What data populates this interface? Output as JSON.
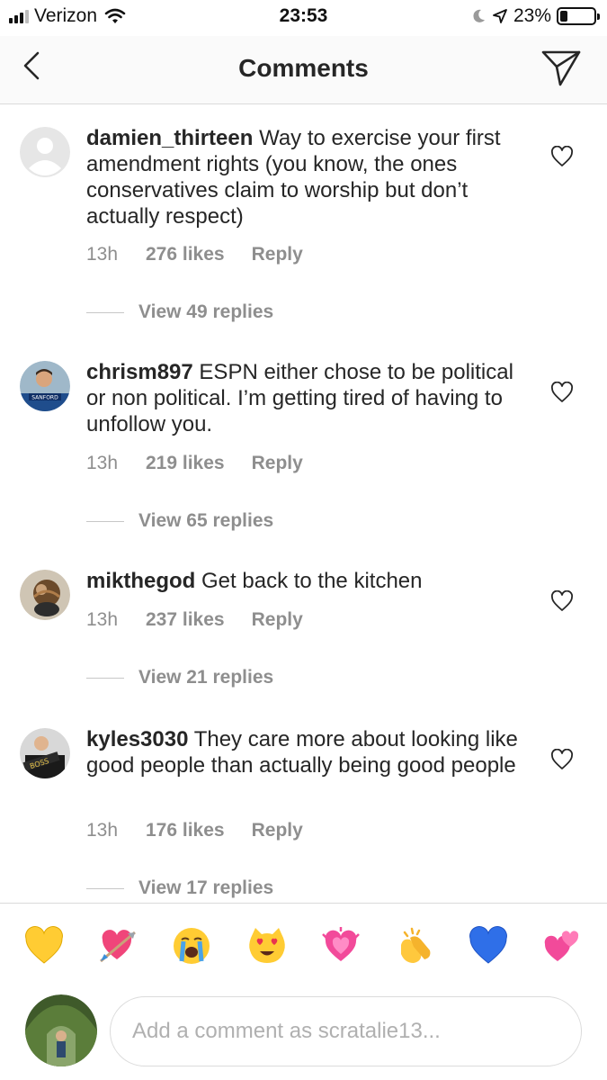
{
  "status_bar": {
    "carrier": "Verizon",
    "time": "23:53",
    "battery_percent": "23%",
    "battery_level": 0.23,
    "signal_bars_filled": 3,
    "signal_bars_total": 4
  },
  "header": {
    "title": "Comments",
    "back_icon": "chevron-left-icon",
    "send_icon": "paper-plane-icon"
  },
  "comments": [
    {
      "username": "damien_thirteen",
      "text": "Way to exercise your first amendment rights (you know, the ones conservatives claim to worship but don’t actually respect)",
      "time": "13h",
      "likes": "276 likes",
      "reply": "Reply",
      "view_replies": "View 49 replies"
    },
    {
      "username": "chrism897",
      "text": "ESPN either chose to be political or non political. I’m getting tired of having to unfollow you.",
      "time": "13h",
      "likes": "219 likes",
      "reply": "Reply",
      "view_replies": "View 65 replies"
    },
    {
      "username": "mikthegod",
      "text": "Get back to the kitchen",
      "time": "13h",
      "likes": "237 likes",
      "reply": "Reply",
      "view_replies": "View 21 replies"
    },
    {
      "username": "kyles3030",
      "text": "They care more about looking like good people than actually being good people",
      "time": "13h",
      "likes": "176 likes",
      "reply": "Reply",
      "view_replies": "View 17 replies"
    }
  ],
  "emoji_bar": [
    "💛",
    "💘",
    "😭",
    "😻",
    "💗",
    "👏",
    "💙",
    "💞"
  ],
  "composer": {
    "placeholder": "Add a comment as scratalie13..."
  },
  "colors": {
    "text": "#262626",
    "secondary_text": "#8e8e8e",
    "divider": "#dbdbdb",
    "header_bg": "#fafafa"
  }
}
